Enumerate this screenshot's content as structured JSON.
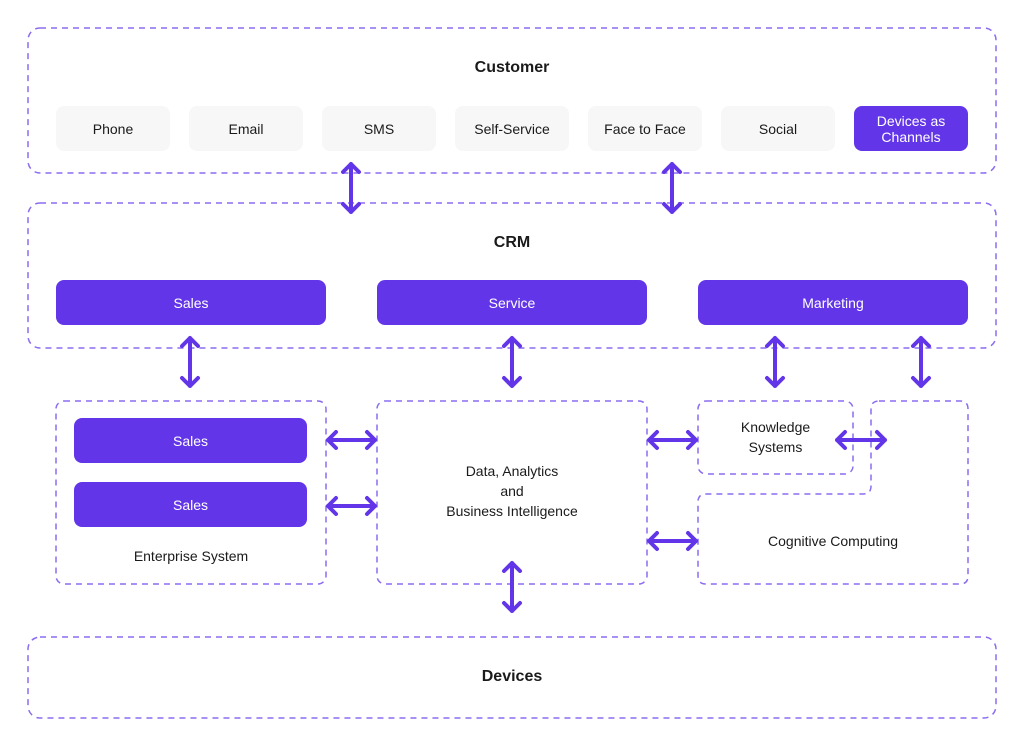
{
  "colors": {
    "accent": "#6236e8",
    "dashed_border": "#8b6cf0",
    "channel_bg": "#f7f7f7"
  },
  "customer": {
    "title": "Customer",
    "channels": [
      "Phone",
      "Email",
      "SMS",
      "Self-Service",
      "Face to Face",
      "Social",
      "Devices as Channels"
    ]
  },
  "crm": {
    "title": "CRM",
    "modules": [
      "Sales",
      "Service",
      "Marketing"
    ]
  },
  "enterprise": {
    "title": "Enterprise System",
    "items": [
      "Sales",
      "Sales"
    ]
  },
  "data_analytics": {
    "title_lines": [
      "Data, Analytics",
      "and",
      "Business Intelligence"
    ]
  },
  "knowledge": {
    "title_lines": [
      "Knowledge",
      "Systems"
    ]
  },
  "cognitive": {
    "title": "Cognitive Computing"
  },
  "devices": {
    "title": "Devices"
  }
}
